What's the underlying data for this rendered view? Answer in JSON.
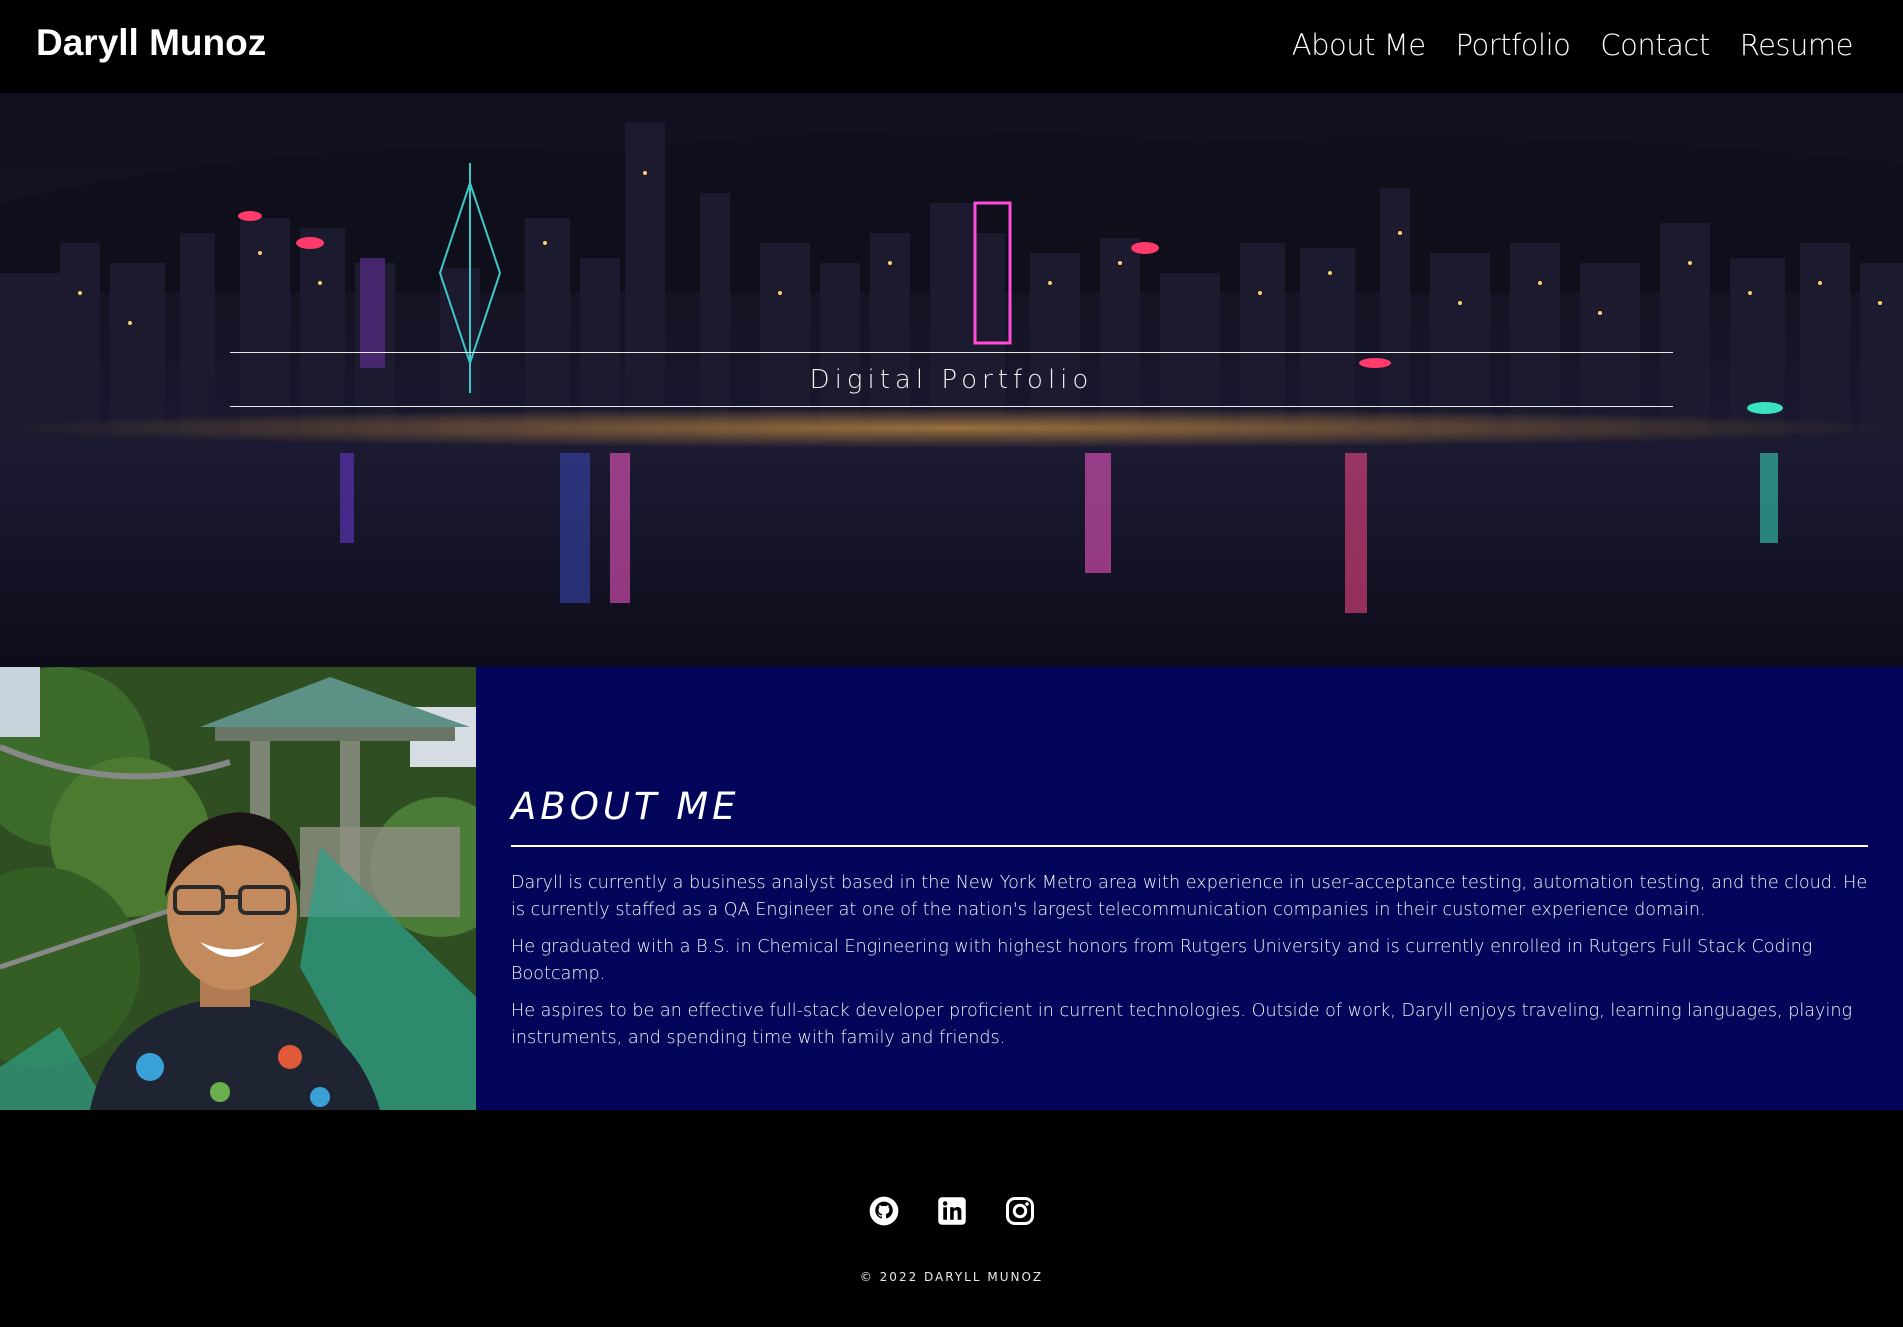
{
  "header": {
    "brand": "Daryll Munoz",
    "nav": [
      {
        "label": "About Me"
      },
      {
        "label": "Portfolio"
      },
      {
        "label": "Contact"
      },
      {
        "label": "Resume"
      }
    ]
  },
  "hero": {
    "title": "Digital Portfolio",
    "image": "city-skyline-night-image"
  },
  "about": {
    "heading": "ABOUT ME",
    "photo": "profile-photo",
    "paragraphs": [
      "Daryll is currently a business analyst based in the New York Metro area with experience in user-acceptance testing, automation testing, and the cloud. He is currently staffed as a QA Engineer at one of the nation's largest telecommunication companies in their customer experience domain.",
      "He graduated with a B.S. in Chemical Engineering with highest honors from Rutgers University and is currently enrolled in Rutgers Full Stack Coding Bootcamp.",
      "He aspires to be an effective full-stack developer proficient in current technologies. Outside of work, Daryll enjoys traveling, learning languages, playing instruments, and spending time with family and friends."
    ]
  },
  "footer": {
    "socials": [
      {
        "icon": "github-icon"
      },
      {
        "icon": "linkedin-icon"
      },
      {
        "icon": "instagram-icon"
      }
    ],
    "copyright": "© 2022 DARYLL MUNOZ"
  },
  "colors": {
    "header_bg": "#000000",
    "about_bg": "#02055a",
    "text": "#ffffff"
  }
}
